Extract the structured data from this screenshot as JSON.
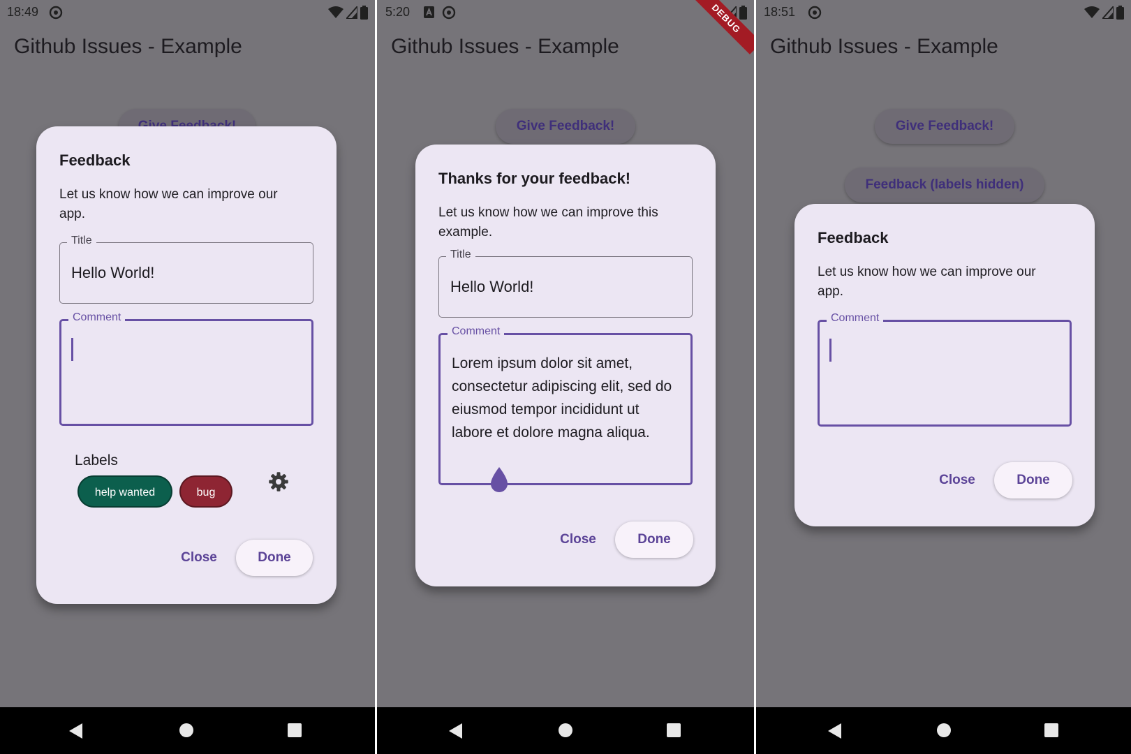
{
  "app": {
    "title": "Github Issues - Example"
  },
  "colors": {
    "scrim": "#767479",
    "dialog_bg": "#ece6f3",
    "accent": "#6750a4",
    "chip_help_wanted": "#0c5f4d",
    "chip_bug": "#8e2533",
    "debug_banner": "#a31b24"
  },
  "screens": [
    {
      "status": {
        "time": "18:49",
        "icons": [
          "location-off-icon",
          "wifi-icon",
          "signal-icon",
          "battery-icon"
        ]
      },
      "background_buttons": [
        "Give Feedback!"
      ],
      "dialog": {
        "title": "Feedback",
        "description": "Let us know how we can improve our app.",
        "title_field": {
          "label": "Title",
          "value": "Hello World!"
        },
        "comment_field": {
          "label": "Comment",
          "value": ""
        },
        "labels": {
          "heading": "Labels",
          "chips": [
            "help wanted",
            "bug"
          ]
        },
        "close_label": "Close",
        "done_label": "Done"
      }
    },
    {
      "status": {
        "time": "5:20",
        "icons": [
          "notification-a-icon",
          "location-off-icon",
          "wifi-icon",
          "signal-icon",
          "battery-icon"
        ]
      },
      "debug_banner": "DEBUG",
      "background_buttons": [
        "Give Feedback!"
      ],
      "dialog": {
        "title": "Thanks for your feedback!",
        "description": "Let us know how we can improve this example.",
        "title_field": {
          "label": "Title",
          "value": "Hello World!"
        },
        "comment_field": {
          "label": "Comment",
          "value": "Lorem ipsum dolor sit amet, consectetur adipiscing elit, sed do eiusmod tempor incididunt ut labore et dolore magna aliqua."
        },
        "close_label": "Close",
        "done_label": "Done"
      }
    },
    {
      "status": {
        "time": "18:51",
        "icons": [
          "location-off-icon",
          "wifi-icon",
          "signal-icon",
          "battery-icon"
        ]
      },
      "background_buttons": [
        "Give Feedback!",
        "Feedback (labels hidden)"
      ],
      "dialog": {
        "title": "Feedback",
        "description": "Let us know how we can improve our app.",
        "comment_field": {
          "label": "Comment",
          "value": ""
        },
        "close_label": "Close",
        "done_label": "Done"
      }
    }
  ],
  "nav": [
    "back-icon",
    "home-icon",
    "recents-icon"
  ]
}
